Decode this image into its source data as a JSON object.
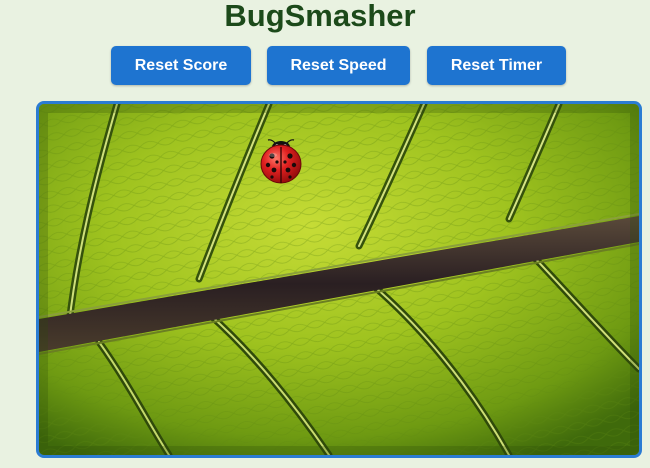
{
  "app": {
    "title": "BugSmasher"
  },
  "toolbar": {
    "reset_score_label": "Reset Score",
    "reset_speed_label": "Reset Speed",
    "reset_timer_label": "Reset Timer"
  },
  "game": {
    "background": "leaf-vein-photo",
    "bug": "ladybug-icon"
  },
  "colors": {
    "page_background": "#e9f2e1",
    "title": "#1c4a1a",
    "button": "#1e74d0",
    "game_border": "#2b7cd3",
    "leaf_light": "#a9c82a",
    "leaf_dark": "#3d6b10",
    "vein": "#3a2a2a",
    "ladybug_red": "#d81e1e"
  }
}
